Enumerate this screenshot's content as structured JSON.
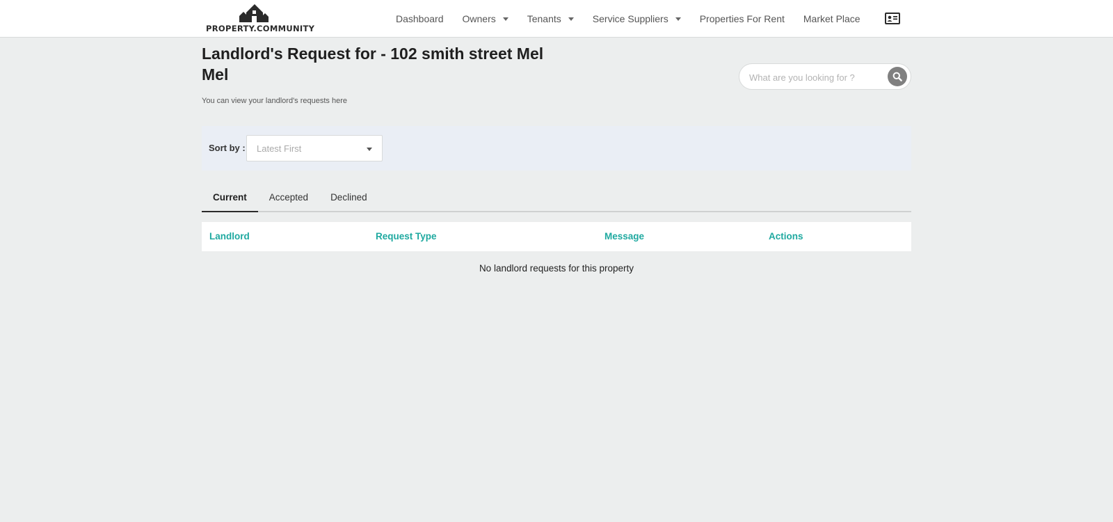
{
  "header": {
    "logo_text": "PROPERTY.COMMUNITY",
    "nav": {
      "dashboard": "Dashboard",
      "owners": "Owners",
      "tenants": "Tenants",
      "service_suppliers": "Service Suppliers",
      "properties_for_rent": "Properties For Rent",
      "market_place": "Market Place"
    },
    "profile_icon": "contact-card-icon"
  },
  "page": {
    "title": "Landlord's Request for - 102 smith street Mel Mel",
    "subtitle": "You can view your landlord's requests here"
  },
  "search": {
    "placeholder": "What are you looking for ?",
    "icon": "search-icon"
  },
  "sort": {
    "label": "Sort by :",
    "selected": "Latest First"
  },
  "tabs": {
    "current": "Current",
    "accepted": "Accepted",
    "declined": "Declined",
    "active": "Current"
  },
  "table": {
    "columns": [
      "Landlord",
      "Request Type",
      "Message",
      "Actions"
    ],
    "empty_message": "No landlord requests for this property"
  },
  "colors": {
    "accent": "#1fa9a0",
    "background": "#eceeee",
    "sort_panel": "#eaeef5"
  }
}
